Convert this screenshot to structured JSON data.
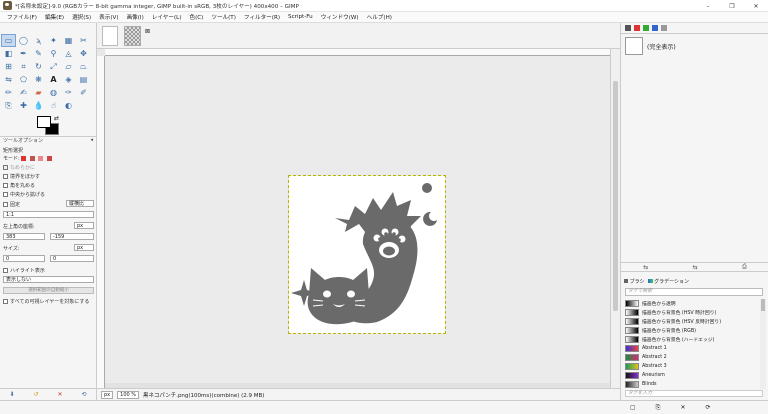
{
  "window": {
    "title": "*[名称未設定]-9.0 (RGBカラー 8-bit gamma integer, GIMP built-in sRGB, 3枚のレイヤー) 400x400 – GIMP",
    "minimize": "–",
    "maximize": "❐",
    "close": "✕"
  },
  "menu": [
    "ファイル(F)",
    "編集(E)",
    "選択(S)",
    "表示(V)",
    "画像(I)",
    "レイヤー(L)",
    "色(C)",
    "ツール(T)",
    "フィルター(R)",
    "Script-Fu",
    "ウィンドウ(W)",
    "ヘルプ(H)"
  ],
  "tool_options": {
    "tab_label": "ツールオプション",
    "title": "矩形選択",
    "mode_label": "モード:",
    "smooth": "なめらかに",
    "feather": "境界をぼかす",
    "round_corners": "角を丸める",
    "expand_center": "中央から拡げる",
    "fixed": "固定",
    "fixed_value": "縦横比",
    "ratio": "1:1",
    "position_label": "左上角の座標:",
    "pos_x": "383",
    "pos_y": "-159",
    "unit": "px",
    "size_label": "サイズ:",
    "size_w": "0",
    "size_h": "0",
    "highlight": "ハイライト表示",
    "guides": "表示しない",
    "auto_shrink": "選択範囲の自動縮小",
    "shrink_merged": "すべての可視レイヤーを対象にする"
  },
  "canvas": {
    "status_unit": "px",
    "zoom": "100 %",
    "status_text": "黒ネコパンチ.png(100ms)(combine) (2.9 MB)"
  },
  "dock": {
    "layer_name": "(完全表示)",
    "tab_brushes": "ブラシ",
    "tab_gradients": "グラデーション",
    "filter_placeholder": "タグで検索",
    "tag_placeholder": "タグを入力",
    "gradients": [
      {
        "name": "描画色から透明",
        "colors": [
          "#000000",
          "#ffffff"
        ]
      },
      {
        "name": "描画色から背景色 (HSV 時計回り)",
        "colors": [
          "#ffffff",
          "#000000"
        ]
      },
      {
        "name": "描画色から背景色 (HSV 反時計回り)",
        "colors": [
          "#ffffff",
          "#000000"
        ]
      },
      {
        "name": "描画色から背景色 (RGB)",
        "colors": [
          "#ffffff",
          "#000000"
        ]
      },
      {
        "name": "描画色から背景色 (ハードエッジ)",
        "colors": [
          "#ffffff",
          "#000000"
        ]
      },
      {
        "name": "Abstract 1",
        "colors": [
          "#3b2fd6",
          "#e8453c"
        ]
      },
      {
        "name": "Abstract 2",
        "colors": [
          "#1f8c3a",
          "#d62b7b"
        ]
      },
      {
        "name": "Abstract 3",
        "colors": [
          "#1c9d52",
          "#e0c21f"
        ]
      },
      {
        "name": "Aneurism",
        "colors": [
          "#111111",
          "#8a2fd1"
        ]
      },
      {
        "name": "Blinds",
        "colors": [
          "#222222",
          "#cccccc"
        ]
      }
    ]
  }
}
